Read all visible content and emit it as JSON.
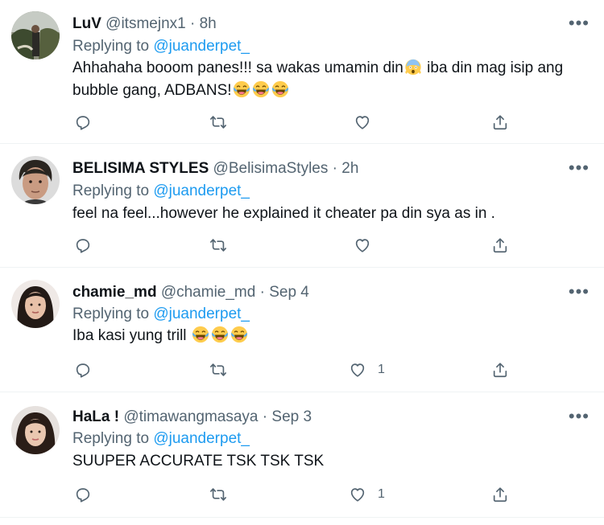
{
  "tweets": [
    {
      "name": "LuV",
      "handle": "@itsmejnx1",
      "separator": "·",
      "time": "8h",
      "replying_prefix": "Replying to",
      "replying_to": "@juanderpet_",
      "text_part1": "Ahhahaha booom panes!!! sa wakas umamin din",
      "text_part2": " iba din mag isip ang bubble gang, ADBANS!",
      "emojis": [
        "scream-emoji",
        "joy-emoji",
        "joy-emoji",
        "joy-emoji"
      ],
      "like_count": ""
    },
    {
      "name": "BELISIMA STYLES",
      "handle": "@BelisimaStyles",
      "separator": "·",
      "time": "2h",
      "replying_prefix": "Replying to",
      "replying_to": "@juanderpet_",
      "text": "feel na feel...however he explained it cheater pa din sya as in .",
      "like_count": ""
    },
    {
      "name": "chamie_md",
      "handle": "@chamie_md",
      "separator": "·",
      "time": "Sep 4",
      "replying_prefix": "Replying to",
      "replying_to": "@juanderpet_",
      "text": "Iba kasi yung trill ",
      "emojis": [
        "joy-emoji",
        "joy-emoji",
        "joy-emoji"
      ],
      "like_count": "1"
    },
    {
      "name": "HaLa !",
      "handle": "@timawangmasaya",
      "separator": "·",
      "time": "Sep 3",
      "replying_prefix": "Replying to",
      "replying_to": "@juanderpet_",
      "text": "SUUPER ACCURATE TSK TSK TSK",
      "like_count": "1"
    }
  ],
  "icons": {
    "reply": "reply-icon",
    "retweet": "retweet-icon",
    "like": "heart-icon",
    "share": "share-icon",
    "more": "more-icon"
  },
  "colors": {
    "link": "#1d9bf0",
    "secondary": "#536471",
    "divider": "#eff3f4"
  }
}
